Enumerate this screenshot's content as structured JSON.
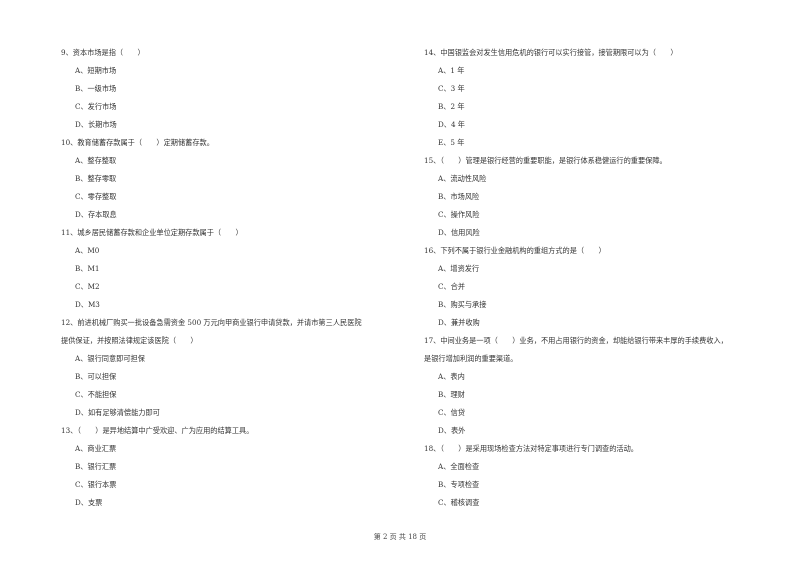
{
  "left_column": [
    {
      "lines": [
        "9、资本市场是指（　　）"
      ],
      "options": [
        "A、短期市场",
        "B、一级市场",
        "C、发行市场",
        "D、长期市场"
      ]
    },
    {
      "lines": [
        "10、教育储蓄存款属于（　　）定期储蓄存款。"
      ],
      "options": [
        "A、整存整取",
        "B、整存零取",
        "C、零存整取",
        "D、存本取息"
      ]
    },
    {
      "lines": [
        "11、城乡居民储蓄存款和企业单位定期存款属于（　　）"
      ],
      "options": [
        "A、M0",
        "B、M1",
        "C、M2",
        "D、M3"
      ]
    },
    {
      "lines": [
        "12、前进机械厂购买一批设备急需资金 500 万元向甲商业银行申请贷款，并请市第三人民医院",
        "提供保证，并按照法律规定该医院（　　）"
      ],
      "options": [
        "A、银行同意即可担保",
        "B、可以担保",
        "C、不能担保",
        "D、如有足够清偿能力即可"
      ]
    },
    {
      "lines": [
        "13、（　　）是异地结算中广受欢迎、广为应用的结算工具。"
      ],
      "options": [
        "A、商业汇票",
        "B、银行汇票",
        "C、银行本票",
        "D、支票"
      ]
    }
  ],
  "right_column": [
    {
      "lines": [
        "14、中国银监会对发生信用危机的银行可以实行接管，接管期限可以为（　　）"
      ],
      "options": [
        "A、1 年",
        "C、3 年",
        "B、2 年",
        "D、4 年",
        "E、5 年"
      ]
    },
    {
      "lines": [
        "15、（　　）管理是银行经营的重要职能，是银行体系稳健运行的重要保障。"
      ],
      "options": [
        "A、流动性风险",
        "B、市场风险",
        "C、操作风险",
        "D、信用风险"
      ]
    },
    {
      "lines": [
        "16、下列不属于银行业金融机构的重组方式的是（　　）"
      ],
      "options": [
        "A、增资发行",
        "C、合并",
        "B、购买与承接",
        "D、兼并收购"
      ]
    },
    {
      "lines": [
        "17、中间业务是一项（　　）业务，不用占用银行的资金，却能给银行带来丰厚的手续费收入，",
        "是银行增加利润的重要渠道。"
      ],
      "options": [
        "A、表内",
        "B、理财",
        "C、信贷",
        "D、表外"
      ]
    },
    {
      "lines": [
        "18、（　　）是采用现场检查方法对特定事项进行专门调查的活动。"
      ],
      "options": [
        "A、全面检查",
        "B、专项检查",
        "C、稽核调查"
      ]
    }
  ],
  "footer": {
    "page_label": "第 2 页 共 18 页"
  }
}
